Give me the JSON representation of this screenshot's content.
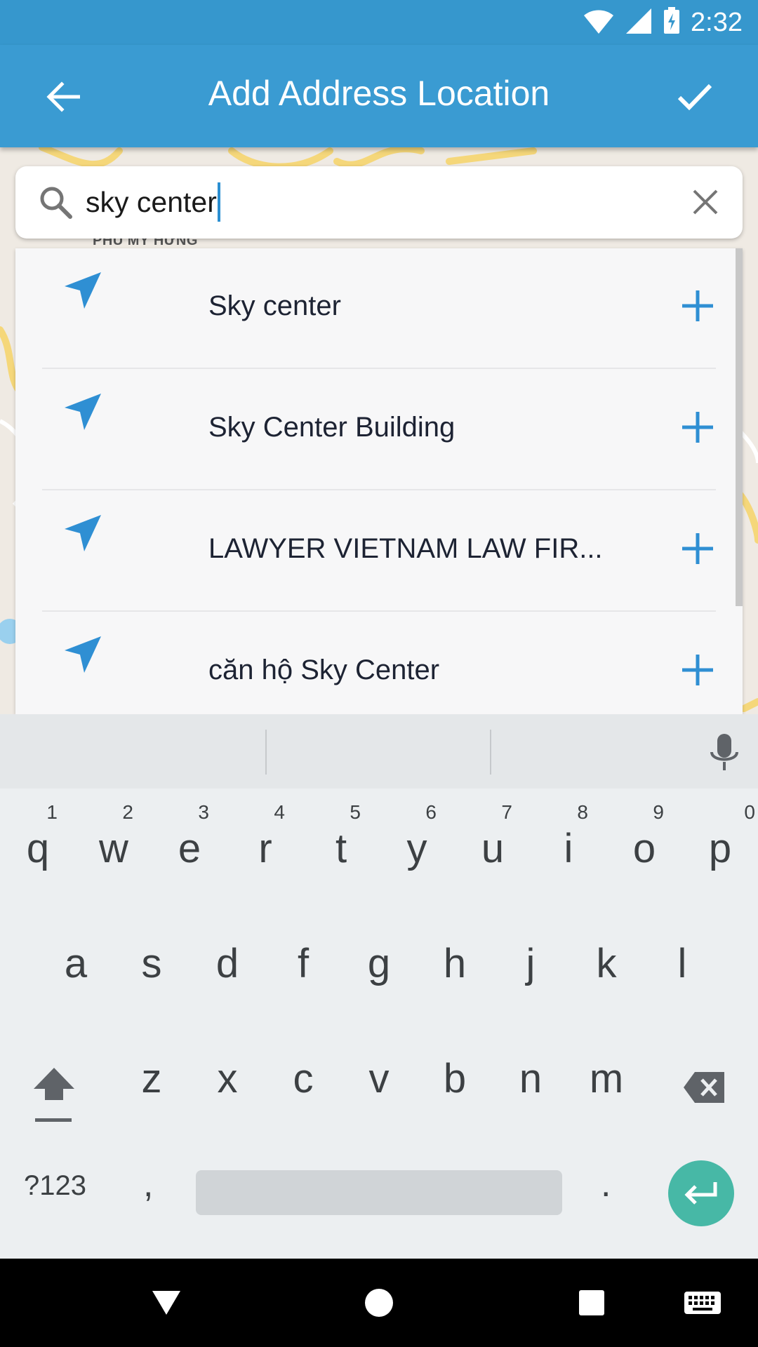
{
  "status_bar": {
    "time": "2:32",
    "icons": [
      "wifi-icon",
      "signal-icon",
      "battery-charging-icon"
    ]
  },
  "app_bar": {
    "title": "Add Address Location",
    "back_icon": "arrow-left-icon",
    "confirm_icon": "check-icon",
    "color": "#3a9bd2"
  },
  "map": {
    "district_label": "PHÚ MỸ HƯNG"
  },
  "search": {
    "value": "sky center",
    "icon": "search-icon",
    "clear_icon": "close-icon"
  },
  "suggestions": [
    {
      "label": "Sky center",
      "icon": "location-arrow-icon",
      "action_icon": "plus-icon"
    },
    {
      "label": "Sky Center Building",
      "icon": "location-arrow-icon",
      "action_icon": "plus-icon"
    },
    {
      "label": "LAWYER VIETNAM LAW FIR...",
      "icon": "location-arrow-icon",
      "action_icon": "plus-icon"
    },
    {
      "label": "căn hộ Sky Center",
      "icon": "location-arrow-icon",
      "action_icon": "plus-icon"
    }
  ],
  "keyboard": {
    "row1": [
      {
        "key": "q",
        "hint": "1"
      },
      {
        "key": "w",
        "hint": "2"
      },
      {
        "key": "e",
        "hint": "3"
      },
      {
        "key": "r",
        "hint": "4"
      },
      {
        "key": "t",
        "hint": "5"
      },
      {
        "key": "y",
        "hint": "6"
      },
      {
        "key": "u",
        "hint": "7"
      },
      {
        "key": "i",
        "hint": "8"
      },
      {
        "key": "o",
        "hint": "9"
      },
      {
        "key": "p",
        "hint": "0"
      }
    ],
    "row2": [
      "a",
      "s",
      "d",
      "f",
      "g",
      "h",
      "j",
      "k",
      "l"
    ],
    "row3": [
      "z",
      "x",
      "c",
      "v",
      "b",
      "n",
      "m"
    ],
    "symbols_label": "?123",
    "comma_label": ",",
    "period_label": ".",
    "accent_color": "#47b8a6"
  },
  "nav_bar": {
    "icons": [
      "back-triangle-icon",
      "home-circle-icon",
      "recents-square-icon",
      "keyboard-icon"
    ]
  }
}
